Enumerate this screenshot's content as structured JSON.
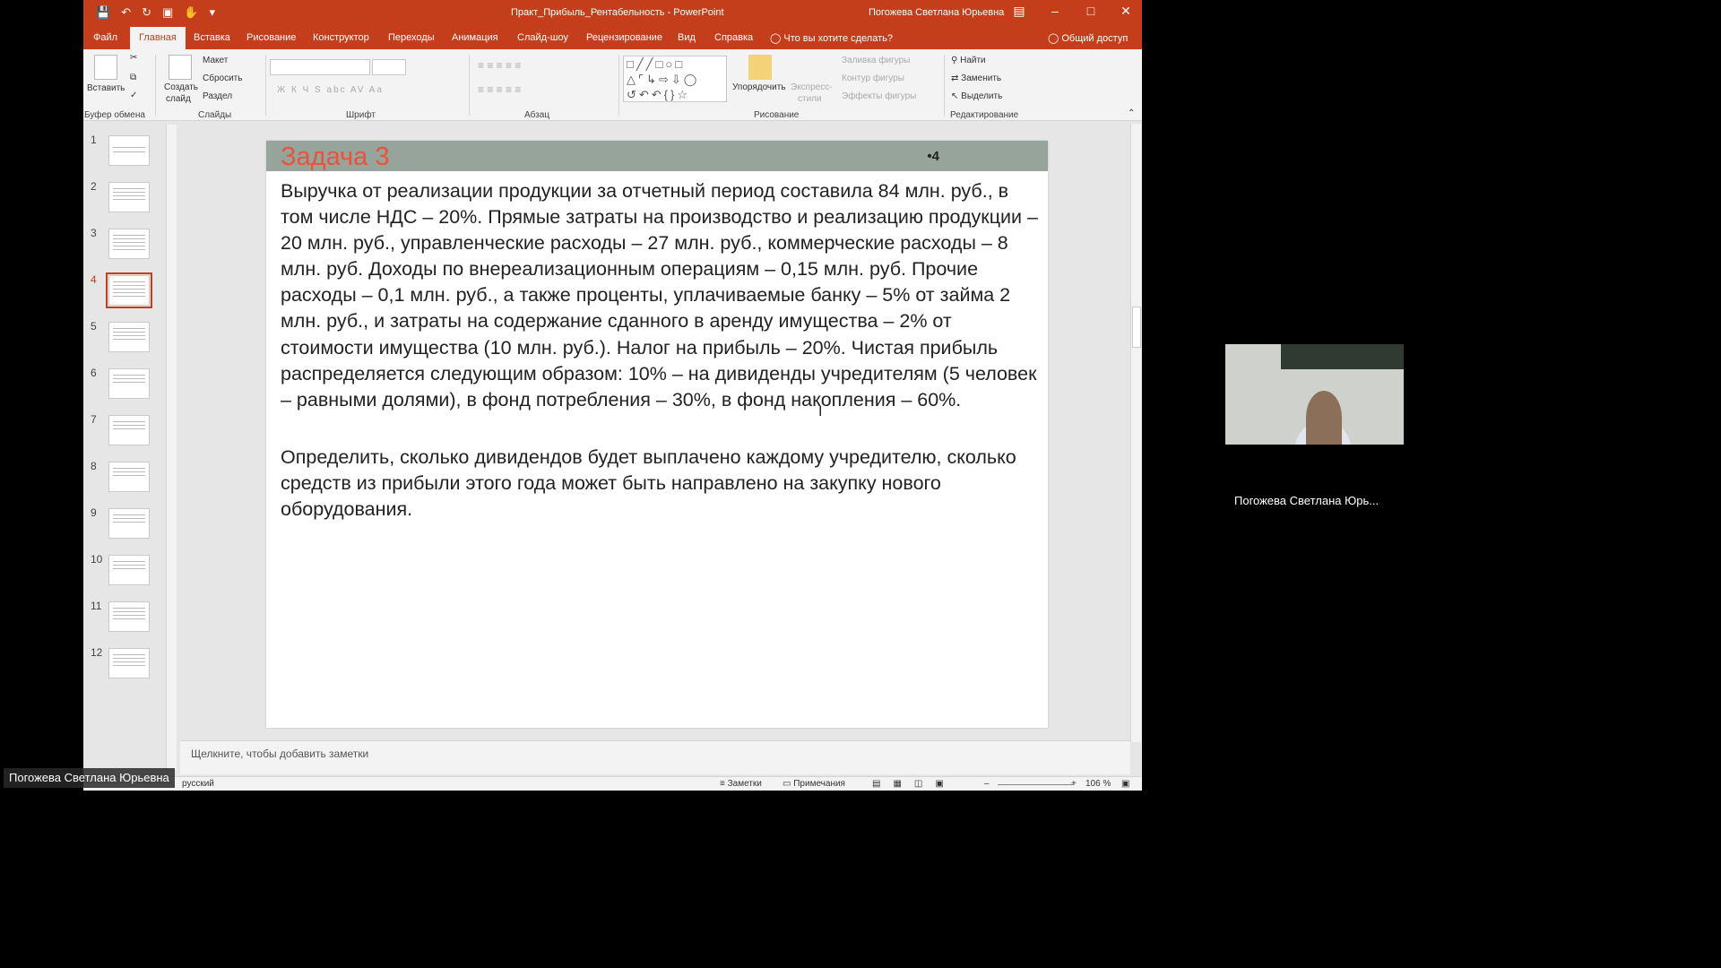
{
  "window": {
    "title": "Практ_Прибыль_Рентабельность - PowerPoint",
    "user": "Погожева Светлана Юрьевна",
    "qa_icons": [
      "save-icon",
      "undo-icon",
      "redo-icon",
      "present-icon",
      "touch-icon",
      "customize-icon"
    ]
  },
  "tabs": [
    "Файл",
    "Главная",
    "Вставка",
    "Рисование",
    "Конструктор",
    "Переходы",
    "Анимация",
    "Слайд-шоу",
    "Рецензирование",
    "Вид",
    "Справка"
  ],
  "tab_search": "Что вы хотите сделать?",
  "share": "Общий доступ",
  "ribbon": {
    "paste": "Вставить",
    "clipboard_group": "Буфер обмена",
    "create_slide_1": "Создать",
    "create_slide_2": "слайд",
    "layout": "Макет",
    "reset": "Сбросить",
    "section": "Раздел",
    "slides_group": "Слайды",
    "font_group": "Шрифт",
    "paragraph_group": "Абзац",
    "arrange": "Упорядочить",
    "quick_styles_1": "Экспресс-",
    "quick_styles_2": "стили",
    "shape_fill": "Заливка фигуры",
    "shape_outline": "Контур фигуры",
    "shape_effects": "Эффекты фигуры",
    "drawing_group": "Рисование",
    "find": "Найти",
    "replace": "Заменить",
    "select": "Выделить",
    "editing_group": "Редактирование",
    "font_format": "Ж  К  Ч  S  abc  AV  Aa"
  },
  "thumbnails": [
    "1",
    "2",
    "3",
    "4",
    "5",
    "6",
    "7",
    "8",
    "9",
    "10",
    "11",
    "12"
  ],
  "active_slide": 4,
  "slide": {
    "title": "Задача 3",
    "number": "•4",
    "paragraph1": "Выручка от реализации продукции за отчетный период составила 84 млн. руб., в том числе НДС – 20%. Прямые затраты на производство и реализацию продукции – 20 млн. руб., управленческие расходы – 27 млн. руб., коммерческие расходы – 8 млн. руб. Доходы по внереализационным операциям – 0,15 млн. руб. Прочие расходы – 0,1 млн. руб., а также проценты, уплачиваемые банку – 5% от займа 2 млн. руб., и затраты на содержание сданного в аренду имущества – 2% от стоимости имущества (10 млн. руб.). Налог на прибыль – 20%. Чистая прибыль распределяется следующим образом: 10%  – на дивиденды учредителям (5 человек – равными долями), в фонд потребления – 30%, в фонд накопления – 60%.",
    "paragraph2": "Определить, сколько дивидендов будет выплачено каждому учредителю, сколько средств из прибыли этого года может быть направлено на закупку нового оборудования."
  },
  "notes_placeholder": "Щелкните, чтобы добавить заметки",
  "status": {
    "language": "русский",
    "notes": "Заметки",
    "comments": "Примечания",
    "zoom": "106 %"
  },
  "video": {
    "participant": "Погожева Светлана Юрь..."
  },
  "overlay_name": "Погожева Светлана Юрьевна"
}
